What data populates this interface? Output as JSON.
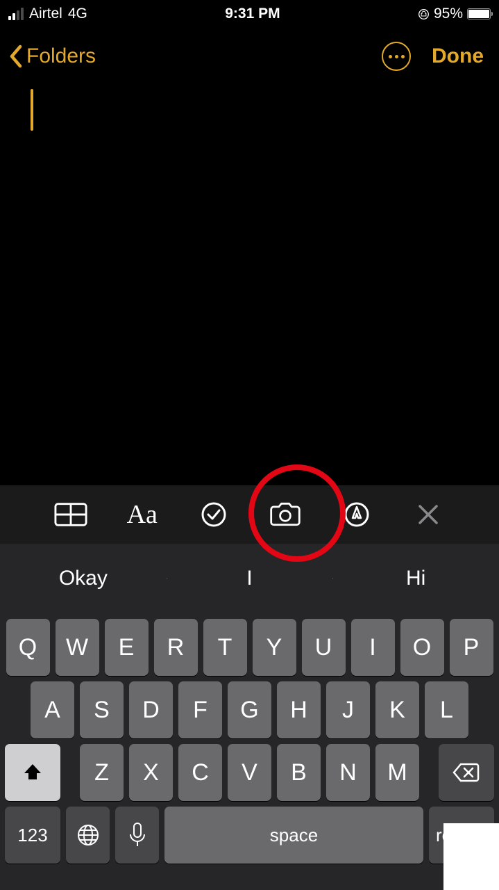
{
  "statusbar": {
    "carrier": "Airtel",
    "network": "4G",
    "time": "9:31 PM",
    "battery_pct": "95%"
  },
  "nav": {
    "back_label": "Folders",
    "done_label": "Done"
  },
  "accessory_icons": [
    "table",
    "text-format",
    "checklist",
    "camera",
    "markup",
    "close"
  ],
  "suggestions": [
    "Okay",
    "I",
    "Hi"
  ],
  "keyboard": {
    "row1": [
      "Q",
      "W",
      "E",
      "R",
      "T",
      "Y",
      "U",
      "I",
      "O",
      "P"
    ],
    "row2": [
      "A",
      "S",
      "D",
      "F",
      "G",
      "H",
      "J",
      "K",
      "L"
    ],
    "row3": [
      "Z",
      "X",
      "C",
      "V",
      "B",
      "N",
      "M"
    ],
    "numkey": "123",
    "space": "space",
    "return": "return"
  }
}
